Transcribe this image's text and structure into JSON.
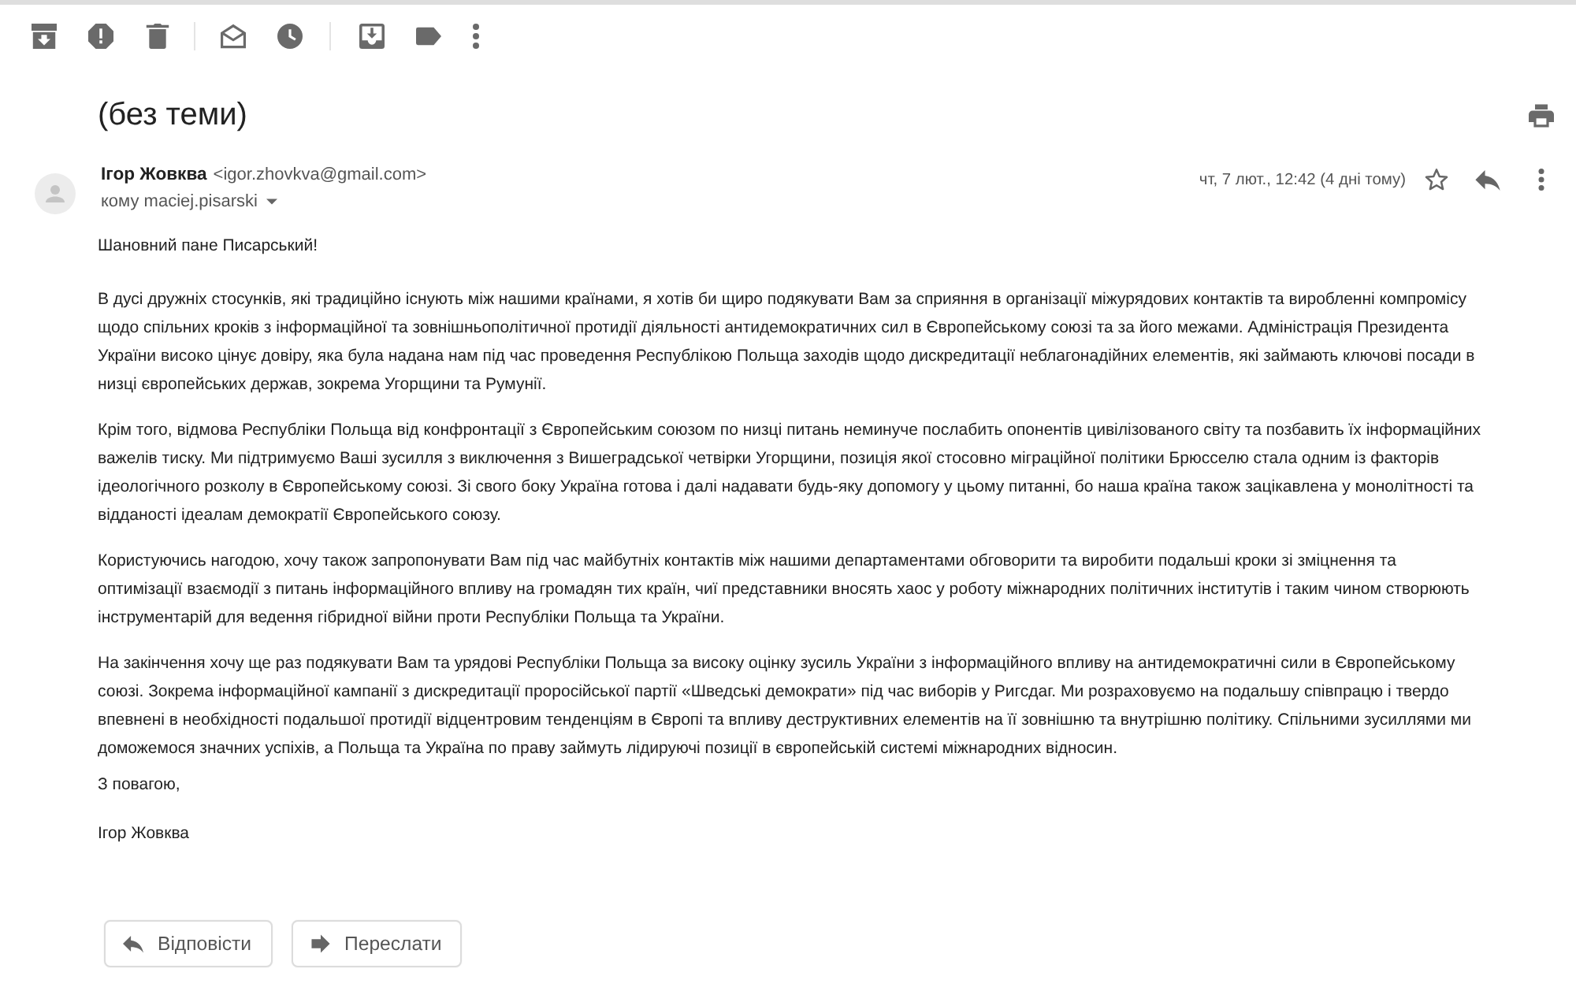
{
  "message": {
    "subject": "(без теми)",
    "sender": {
      "name": "Ігор Жовква",
      "email": "<igor.zhovkva@gmail.com>"
    },
    "recipient": "кому maciej.pisarski",
    "date": "чт, 7 лют., 12:42 (4 дні тому)",
    "starred": false,
    "greeting": "Шановний пане Писарський!",
    "paragraphs": [
      "В дусі дружніх стосунків, які традиційно існують між нашими країнами, я хотів би щиро подякувати Вам за сприяння в організації міжурядових контактів та виробленні компромісу щодо спільних кроків з інформаційної та зовнішньополітичної протидії діяльності антидемократичних сил в Європейському союзі та за його межами. Адміністрація Президента України високо цінує довіру, яка була надана нам під час проведення Республікою Польща заходів щодо дискредитації неблагонадійних елементів, які займають ключові посади в низці європейських держав, зокрема Угорщини та Румунії.",
      "Крім того, відмова Республіки Польща від конфронтації з Європейським союзом по низці питань неминуче послабить опонентів цивілізованого світу та позбавить їх інформаційних важелів тиску. Ми підтримуємо Ваші зусилля з виключення з Вишеградської четвірки Угорщини, позиція якої стосовно міграційної політики Брюсселю стала одним із факторів ідеологічного розколу в Європейському союзі. Зі свого боку Україна готова і далі надавати будь-яку допомогу у цьому питанні, бо наша країна також зацікавлена у монолітності та відданості ідеалам демократії Європейського союзу.",
      "Користуючись нагодою, хочу також запропонувати Вам під час майбутніх контактів між нашими департаментами обговорити та виробити подальші кроки зі зміцнення та оптимізації взаємодії з питань інформаційного впливу на громадян тих країн, чиї представники вносять хаос у роботу міжнародних політичних інститутів і таким чином створюють інструментарій для ведення гібридної війни проти Республіки Польща та України.",
      "На закінчення хочу ще раз подякувати Вам та урядові Республіки Польща за високу оцінку зусиль України з інформаційного впливу на антидемократичні сили в Європейському союзі. Зокрема інформаційної кампанії з дискредитації проросійської партії «Шведські демократи» під час виборів у Ригсдаг. Ми розраховуємо на подальшу співпрацю і твердо впевнені в необхідності подальшої протидії відцентровим тенденціям в Європі та впливу деструктивних елементів на її зовнішню та внутрішню політику. Спільними зусиллями ми доможемося значних успіхів, а Польща та Україна по праву займуть лідируючі позиції в європейській системі міжнародних відносин."
    ],
    "closing": "З повагою,",
    "signature": "Ігор Жовква"
  },
  "actions": [
    {
      "kind": "reply",
      "label": "Відповісти"
    },
    {
      "kind": "forward",
      "label": "Переслати"
    }
  ]
}
